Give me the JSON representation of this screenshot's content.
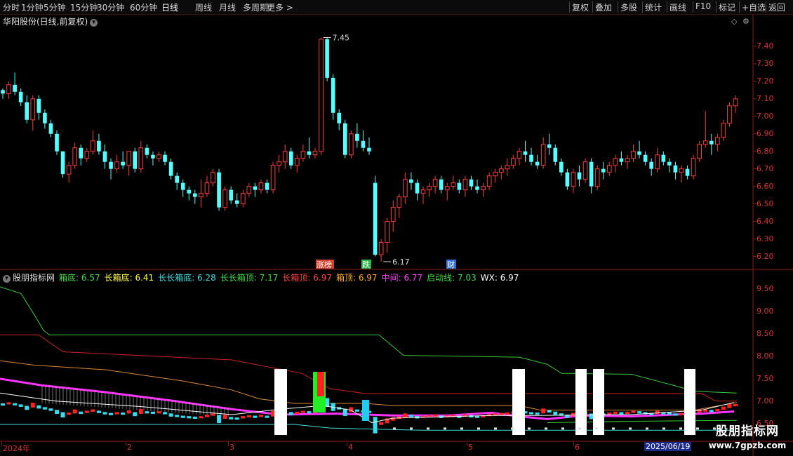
{
  "toolbar": {
    "left_items": [
      "分时",
      "1分钟",
      "5分钟",
      "15分钟",
      "30分钟",
      "60分钟",
      "日线",
      "周线",
      "月线",
      "多周期",
      "更多 >"
    ],
    "active_item": "日线",
    "right_items": [
      "复权",
      "叠加",
      "多股",
      "统计",
      "画线",
      "F10",
      "标记",
      "+自选",
      "返回"
    ]
  },
  "main_chart": {
    "title": "华阳股份(日线,前复权)",
    "y_ticks": [
      "7.40",
      "7.30",
      "7.20",
      "7.10",
      "7.00",
      "6.90",
      "6.80",
      "6.70",
      "6.60",
      "6.50",
      "6.40",
      "6.30",
      "6.20"
    ],
    "annotations": {
      "high_label": "7.45",
      "low_label": "6.17",
      "markers": [
        {
          "text": "涨榜",
          "color": "#d4402a"
        },
        {
          "text": "跌",
          "color": "#2fb84a"
        },
        {
          "text": "财",
          "color": "#2f6fd4"
        }
      ]
    },
    "up_color": "#ff3c3c",
    "down_color": "#54ffff"
  },
  "indicator": {
    "name": "股朋指标网",
    "items": [
      {
        "label": "箱底:",
        "value": "6.57",
        "color": "#44dd44"
      },
      {
        "label": "长箱底:",
        "value": "6.41",
        "color": "#ffff44"
      },
      {
        "label": "长长箱底:",
        "value": "6.28",
        "color": "#44dddd"
      },
      {
        "label": "长长箱顶:",
        "value": "7.17",
        "color": "#44dd44"
      },
      {
        "label": "长箱顶:",
        "value": "6.97",
        "color": "#ff4444"
      },
      {
        "label": "箱顶:",
        "value": "6.97",
        "color": "#ffaa33"
      },
      {
        "label": "中间:",
        "value": "6.77",
        "color": "#ff44ff"
      },
      {
        "label": "启动线:",
        "value": "7.03",
        "color": "#44dd44"
      },
      {
        "label": "WX:",
        "value": "6.97",
        "color": "#ffffff"
      }
    ],
    "y_ticks": [
      "9.50",
      "9.00",
      "8.50",
      "8.00",
      "7.50",
      "7.00",
      "6.50"
    ]
  },
  "chart_data": {
    "type": "candlestick",
    "title": "华阳股份(日线,前复权)",
    "ylim": [
      6.13,
      7.52
    ],
    "ohlc": [
      [
        7.15,
        7.16,
        7.1,
        7.13
      ],
      [
        7.13,
        7.2,
        7.1,
        7.18
      ],
      [
        7.18,
        7.25,
        7.12,
        7.14
      ],
      [
        7.14,
        7.16,
        7.06,
        7.08
      ],
      [
        7.08,
        7.12,
        6.96,
        6.98
      ],
      [
        6.98,
        7.12,
        6.92,
        7.1
      ],
      [
        7.1,
        7.12,
        6.98,
        7.02
      ],
      [
        7.02,
        7.04,
        6.93,
        6.96
      ],
      [
        6.96,
        6.98,
        6.88,
        6.9
      ],
      [
        6.9,
        6.92,
        6.78,
        6.8
      ],
      [
        6.8,
        6.8,
        6.65,
        6.67
      ],
      [
        6.67,
        6.74,
        6.62,
        6.72
      ],
      [
        6.72,
        6.85,
        6.7,
        6.82
      ],
      [
        6.82,
        6.84,
        6.72,
        6.76
      ],
      [
        6.76,
        6.82,
        6.74,
        6.8
      ],
      [
        6.8,
        6.92,
        6.78,
        6.86
      ],
      [
        6.86,
        6.9,
        6.78,
        6.8
      ],
      [
        6.8,
        6.84,
        6.7,
        6.74
      ],
      [
        6.74,
        6.76,
        6.64,
        6.7
      ],
      [
        6.7,
        6.78,
        6.68,
        6.74
      ],
      [
        6.74,
        6.8,
        6.7,
        6.72
      ],
      [
        6.72,
        6.78,
        6.66,
        6.8
      ],
      [
        6.8,
        6.82,
        6.68,
        6.7
      ],
      [
        6.7,
        6.86,
        6.68,
        6.82
      ],
      [
        6.82,
        6.84,
        6.76,
        6.78
      ],
      [
        6.78,
        6.8,
        6.72,
        6.76
      ],
      [
        6.76,
        6.8,
        6.74,
        6.78
      ],
      [
        6.78,
        6.8,
        6.72,
        6.74
      ],
      [
        6.74,
        6.76,
        6.64,
        6.66
      ],
      [
        6.66,
        6.68,
        6.58,
        6.62
      ],
      [
        6.62,
        6.64,
        6.54,
        6.58
      ],
      [
        6.58,
        6.6,
        6.52,
        6.56
      ],
      [
        6.56,
        6.58,
        6.5,
        6.54
      ],
      [
        6.54,
        6.64,
        6.48,
        6.56
      ],
      [
        6.56,
        6.66,
        6.54,
        6.62
      ],
      [
        6.62,
        6.7,
        6.6,
        6.68
      ],
      [
        6.68,
        6.7,
        6.46,
        6.48
      ],
      [
        6.48,
        6.6,
        6.46,
        6.58
      ],
      [
        6.58,
        6.6,
        6.5,
        6.52
      ],
      [
        6.52,
        6.56,
        6.48,
        6.5
      ],
      [
        6.5,
        6.58,
        6.48,
        6.56
      ],
      [
        6.56,
        6.62,
        6.54,
        6.6
      ],
      [
        6.6,
        6.62,
        6.54,
        6.58
      ],
      [
        6.58,
        6.64,
        6.56,
        6.62
      ],
      [
        6.62,
        6.64,
        6.56,
        6.58
      ],
      [
        6.58,
        6.74,
        6.56,
        6.72
      ],
      [
        6.72,
        6.78,
        6.68,
        6.74
      ],
      [
        6.74,
        6.84,
        6.7,
        6.8
      ],
      [
        6.8,
        6.82,
        6.7,
        6.72
      ],
      [
        6.72,
        6.78,
        6.68,
        6.76
      ],
      [
        6.76,
        6.84,
        6.74,
        6.8
      ],
      [
        6.8,
        6.88,
        6.76,
        6.78
      ],
      [
        6.78,
        6.82,
        6.76,
        6.8
      ],
      [
        6.8,
        7.45,
        6.78,
        7.44
      ],
      [
        7.44,
        7.45,
        7.2,
        7.22
      ],
      [
        7.22,
        7.24,
        6.98,
        7.02
      ],
      [
        7.02,
        7.04,
        6.92,
        6.96
      ],
      [
        6.96,
        6.98,
        6.76,
        6.78
      ],
      [
        6.78,
        6.92,
        6.76,
        6.9
      ],
      [
        6.9,
        6.96,
        6.82,
        6.86
      ],
      [
        6.86,
        6.92,
        6.8,
        6.82
      ],
      [
        6.82,
        6.88,
        6.78,
        6.8
      ],
      [
        6.62,
        6.66,
        6.2,
        6.21
      ],
      [
        6.21,
        6.3,
        6.17,
        6.28
      ],
      [
        6.28,
        6.42,
        6.22,
        6.4
      ],
      [
        6.4,
        6.52,
        6.34,
        6.48
      ],
      [
        6.48,
        6.56,
        6.42,
        6.54
      ],
      [
        6.54,
        6.68,
        6.5,
        6.64
      ],
      [
        6.64,
        6.68,
        6.58,
        6.62
      ],
      [
        6.62,
        6.64,
        6.52,
        6.56
      ],
      [
        6.56,
        6.6,
        6.5,
        6.58
      ],
      [
        6.58,
        6.62,
        6.54,
        6.6
      ],
      [
        6.6,
        6.66,
        6.56,
        6.64
      ],
      [
        6.64,
        6.66,
        6.56,
        6.58
      ],
      [
        6.58,
        6.62,
        6.52,
        6.6
      ],
      [
        6.6,
        6.66,
        6.58,
        6.62
      ],
      [
        6.62,
        6.64,
        6.56,
        6.58
      ],
      [
        6.58,
        6.66,
        6.54,
        6.64
      ],
      [
        6.64,
        6.66,
        6.58,
        6.6
      ],
      [
        6.6,
        6.64,
        6.56,
        6.58
      ],
      [
        6.58,
        6.62,
        6.54,
        6.6
      ],
      [
        6.6,
        6.68,
        6.58,
        6.66
      ],
      [
        6.66,
        6.7,
        6.62,
        6.68
      ],
      [
        6.68,
        6.72,
        6.64,
        6.7
      ],
      [
        6.7,
        6.76,
        6.66,
        6.72
      ],
      [
        6.72,
        6.78,
        6.7,
        6.76
      ],
      [
        6.76,
        6.82,
        6.72,
        6.8
      ],
      [
        6.8,
        6.86,
        6.74,
        6.78
      ],
      [
        6.78,
        6.82,
        6.72,
        6.74
      ],
      [
        6.74,
        6.78,
        6.7,
        6.72
      ],
      [
        6.72,
        6.88,
        6.7,
        6.84
      ],
      [
        6.84,
        6.9,
        6.78,
        6.82
      ],
      [
        6.82,
        6.84,
        6.72,
        6.74
      ],
      [
        6.74,
        6.76,
        6.66,
        6.68
      ],
      [
        6.68,
        6.7,
        6.58,
        6.6
      ],
      [
        6.6,
        6.7,
        6.56,
        6.68
      ],
      [
        6.68,
        6.72,
        6.6,
        6.64
      ],
      [
        6.64,
        6.76,
        6.62,
        6.74
      ],
      [
        6.74,
        6.76,
        6.56,
        6.6
      ],
      [
        6.6,
        6.72,
        6.58,
        6.7
      ],
      [
        6.7,
        6.74,
        6.64,
        6.68
      ],
      [
        6.68,
        6.74,
        6.66,
        6.72
      ],
      [
        6.72,
        6.78,
        6.68,
        6.76
      ],
      [
        6.76,
        6.8,
        6.72,
        6.74
      ],
      [
        6.74,
        6.78,
        6.7,
        6.76
      ],
      [
        6.76,
        6.84,
        6.74,
        6.8
      ],
      [
        6.8,
        6.86,
        6.76,
        6.78
      ],
      [
        6.78,
        6.8,
        6.72,
        6.74
      ],
      [
        6.74,
        6.76,
        6.66,
        6.7
      ],
      [
        6.7,
        6.82,
        6.68,
        6.78
      ],
      [
        6.78,
        6.8,
        6.72,
        6.74
      ],
      [
        6.74,
        6.76,
        6.68,
        6.72
      ],
      [
        6.72,
        6.74,
        6.64,
        6.68
      ],
      [
        6.68,
        6.72,
        6.62,
        6.7
      ],
      [
        6.7,
        6.72,
        6.64,
        6.66
      ],
      [
        6.66,
        6.78,
        6.64,
        6.76
      ],
      [
        6.76,
        6.86,
        6.74,
        6.84
      ],
      [
        6.84,
        7.03,
        6.82,
        6.86
      ],
      [
        6.86,
        6.9,
        6.78,
        6.84
      ],
      [
        6.84,
        6.9,
        6.8,
        6.88
      ],
      [
        6.88,
        6.98,
        6.86,
        6.96
      ],
      [
        6.96,
        7.08,
        6.94,
        7.06
      ],
      [
        7.06,
        7.12,
        7.02,
        7.1
      ]
    ],
    "indicator_series": [
      {
        "name": "长长箱顶",
        "color": "#33cc33"
      },
      {
        "name": "长箱顶",
        "color": "#cc2222"
      },
      {
        "name": "箱顶",
        "color": "#dd8833"
      },
      {
        "name": "中间",
        "color": "#ff33ff"
      },
      {
        "name": "启动线",
        "color": "#33cc33"
      },
      {
        "name": "WX",
        "color": "#ffffff"
      }
    ]
  },
  "x_axis": {
    "labels": [
      "2024年",
      "2",
      "3",
      "4",
      "5",
      "6"
    ],
    "current_date": "2025/06/19"
  },
  "watermark": {
    "title": "股朋指标网",
    "url": "www.7gpzb.com"
  }
}
